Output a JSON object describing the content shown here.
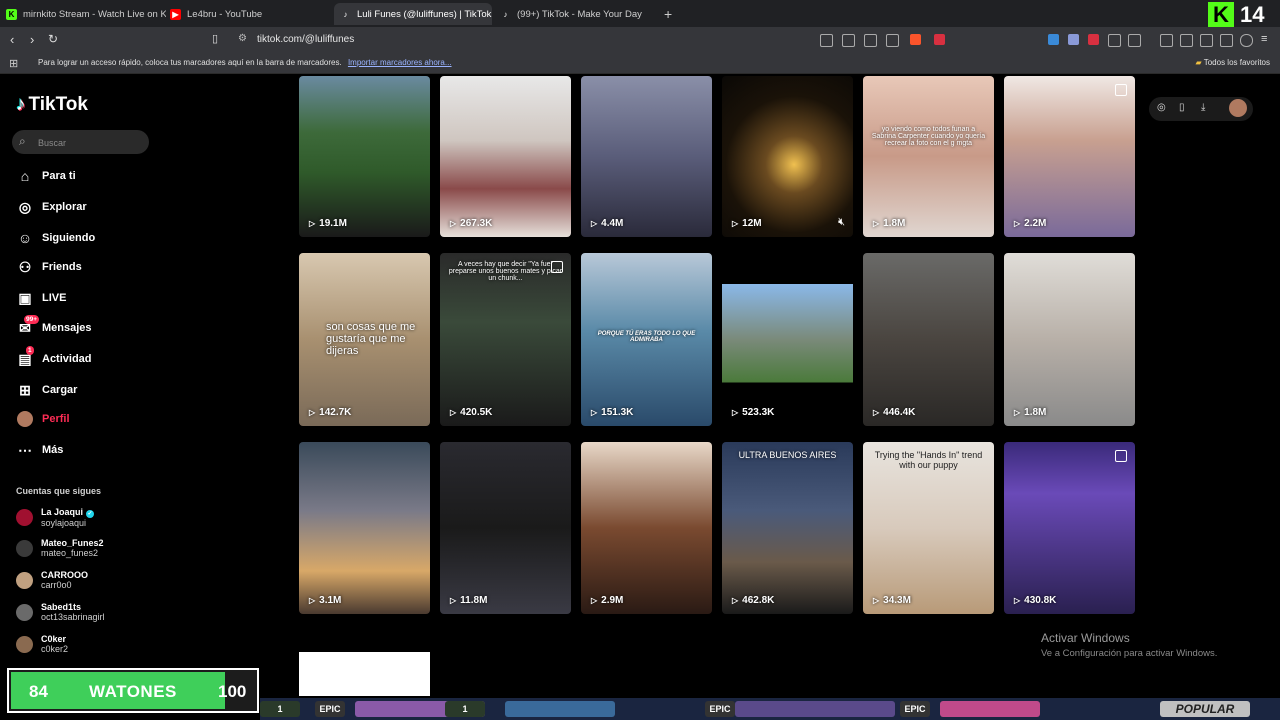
{
  "browser": {
    "tabs": [
      {
        "title": "mirnkito Stream - Watch Live on Kick",
        "icon": "kick-icon",
        "color": "#53fc18"
      },
      {
        "title": "Le4bru - YouTube",
        "icon": "youtube-icon",
        "color": "#ff0000"
      },
      {
        "title": "Luli Funes (@luliffunes) | TikTok",
        "icon": "tiktok-icon",
        "color": "#000000"
      },
      {
        "title": "(99+) TikTok - Make Your Day",
        "icon": "tiktok-icon",
        "color": "#000000"
      }
    ],
    "url": "tiktok.com/@luliffunes",
    "bookmarks_hint": "Para lograr un acceso rápido, coloca tus marcadores aquí en la barra de marcadores.",
    "bookmarks_link": "Importar marcadores ahora...",
    "bookmarks_folder": "Todos los favoritos",
    "kick_count": "14"
  },
  "sidebar": {
    "logo": "TikTok",
    "search_placeholder": "Buscar",
    "items": [
      {
        "label": "Para ti",
        "icon": "home-icon"
      },
      {
        "label": "Explorar",
        "icon": "compass-icon"
      },
      {
        "label": "Siguiendo",
        "icon": "following-icon"
      },
      {
        "label": "Friends",
        "icon": "friends-icon"
      },
      {
        "label": "LIVE",
        "icon": "live-icon"
      },
      {
        "label": "Mensajes",
        "icon": "messages-icon",
        "badge": "99+"
      },
      {
        "label": "Actividad",
        "icon": "activity-icon",
        "badge": "1"
      },
      {
        "label": "Cargar",
        "icon": "upload-icon"
      },
      {
        "label": "Perfil",
        "icon": "profile-avatar",
        "active": true
      },
      {
        "label": "Más",
        "icon": "more-icon"
      }
    ],
    "following_title": "Cuentas que sigues",
    "following": [
      {
        "name": "La Joaqui",
        "handle": "soylajoaqui",
        "verified": true,
        "color": "#a01030"
      },
      {
        "name": "Mateo_Funes2",
        "handle": "mateo_funes2",
        "color": "#3a3a3a"
      },
      {
        "name": "CARROOO",
        "handle": "carr0o0",
        "color": "#c0a080"
      },
      {
        "name": "Sabed1ts",
        "handle": "oct13sabrinagirl",
        "color": "#6a6a6a"
      },
      {
        "name": "C0ker",
        "handle": "c0ker2",
        "color": "#8a6a50"
      }
    ]
  },
  "videos": [
    {
      "views": "19.1M",
      "bg": "linear-gradient(180deg,#6a8aa0 0%,#3d6a3a 35%,#2f5a2a 60%,#1a1a1a 100%)"
    },
    {
      "views": "267.3K",
      "bg": "linear-gradient(180deg,#e8e8e8 0%,#cfc6c0 40%,#8a4a4a 70%,#e6e0da 100%)"
    },
    {
      "views": "4.4M",
      "bg": "linear-gradient(180deg,#8a8fa8 0%,#5a5d7a 50%,#2a2a3a 100%)"
    },
    {
      "views": "12M",
      "bg": "radial-gradient(circle at 55% 55%,#f0c050 0%,#6a4a20 25%,#1a1208 60%,#0a0806 100%)",
      "muted": true
    },
    {
      "views": "1.8M",
      "bg": "linear-gradient(180deg,#e8c8b8 0%,#c89a88 50%,#e0d6d0 100%)",
      "caption": "yo viendo como todos funan a Sabrina Carpenter cuando yo quería recrear la foto con el g mgta"
    },
    {
      "views": "2.2M",
      "bg": "linear-gradient(180deg,#f0e8e4 0%,#c8a090 40%,#7a6a9a 100%)"
    },
    {
      "views": "142.7K",
      "bg": "linear-gradient(180deg,#d8c8b0 0%,#a89070 50%,#7a6a58 100%)",
      "caption": "son cosas que me gustaría que me dijeras"
    },
    {
      "views": "420.5K",
      "bg": "linear-gradient(180deg,#2a2a2a 0%,#3a4a3a 40%,#1a1a1a 100%)",
      "caption": "A veces hay que decir \"Ya fue\" preparse unos buenos mates y picar un chunk..."
    },
    {
      "views": "151.3K",
      "bg": "linear-gradient(180deg,#b8c8d8 0%,#5a8aa8 45%,#2a4a6a 100%)",
      "caption": "PORQUE TÚ ERAS TODO LO QUE ADMIRABA"
    },
    {
      "views": "523.3K",
      "bg": "linear-gradient(180deg,#000 0%,#000 18%,#8ab8e8 18%,#7a8a7a 50%,#4a7a3a 75%,#000 75%,#000 100%)"
    },
    {
      "views": "446.4K",
      "bg": "linear-gradient(180deg,#6a6a68 0%,#4a4540 50%,#2a2826 100%)"
    },
    {
      "views": "1.8M",
      "bg": "linear-gradient(180deg,#e0ddd8 0%,#b8b0a8 50%,#8a8a8a 100%)"
    },
    {
      "views": "3.1M",
      "bg": "linear-gradient(180deg,#3a4a5a 0%,#7a7a88 40%,#d8a868 75%,#4a3a30 100%)"
    },
    {
      "views": "11.8M",
      "bg": "linear-gradient(180deg,#2a2a30 0%,#1a1a1a 50%,#3a3a44 100%)"
    },
    {
      "views": "2.9M",
      "bg": "linear-gradient(180deg,#e8d8c8 0%,#7a4a30 50%,#2a1a14 100%)"
    },
    {
      "views": "462.8K",
      "bg": "linear-gradient(180deg,#2a3a5a 0%,#4a5a7a 40%,#6a5a4a 70%,#1a1a1a 100%)",
      "caption": "ULTRA BUENOS AIRES"
    },
    {
      "views": "34.3M",
      "bg": "linear-gradient(180deg,#e8e4de 0%,#d8cabc 50%,#b89a78 100%)",
      "caption": "Trying the \"Hands In\" trend with our puppy"
    },
    {
      "views": "430.8K",
      "bg": "linear-gradient(180deg,#3a2a7a 0%,#6a4ab8 30%,#2a2050 100%)"
    }
  ],
  "windows": {
    "activate_title": "Activar Windows",
    "activate_sub": "Ve a Configuración para activar Windows."
  },
  "watones": {
    "min": "84",
    "label": "WATONES",
    "max": "100",
    "progress": 0.84
  },
  "taskbar": [
    "1",
    "EPIC",
    "1",
    "EPIC",
    "EPIC",
    "POPULAR"
  ]
}
